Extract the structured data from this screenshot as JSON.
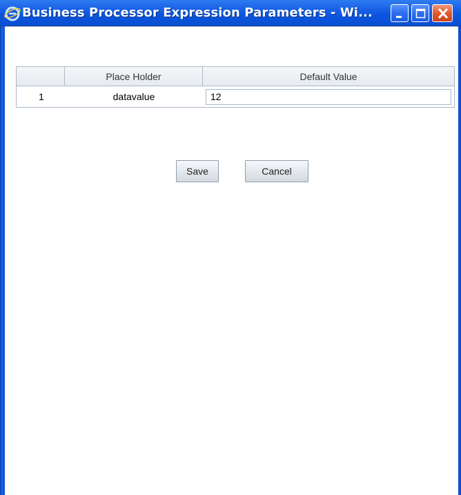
{
  "window": {
    "title": "Business Processor Expression Parameters - Wi...",
    "icon": "internet-explorer-icon",
    "controls": [
      "minimize-icon",
      "maximize-icon",
      "close-icon"
    ]
  },
  "table": {
    "columns": [
      "",
      "Place Holder",
      "Default Value"
    ],
    "rows": [
      {
        "index": "1",
        "placeholder": "datavalue",
        "default_value": "12"
      }
    ]
  },
  "buttons": {
    "save_label": "Save",
    "cancel_label": "Cancel"
  },
  "colors": {
    "titlebar": "#0b4fd1",
    "close_button": "#e35a2f",
    "grid_border": "#a9b8c6"
  }
}
